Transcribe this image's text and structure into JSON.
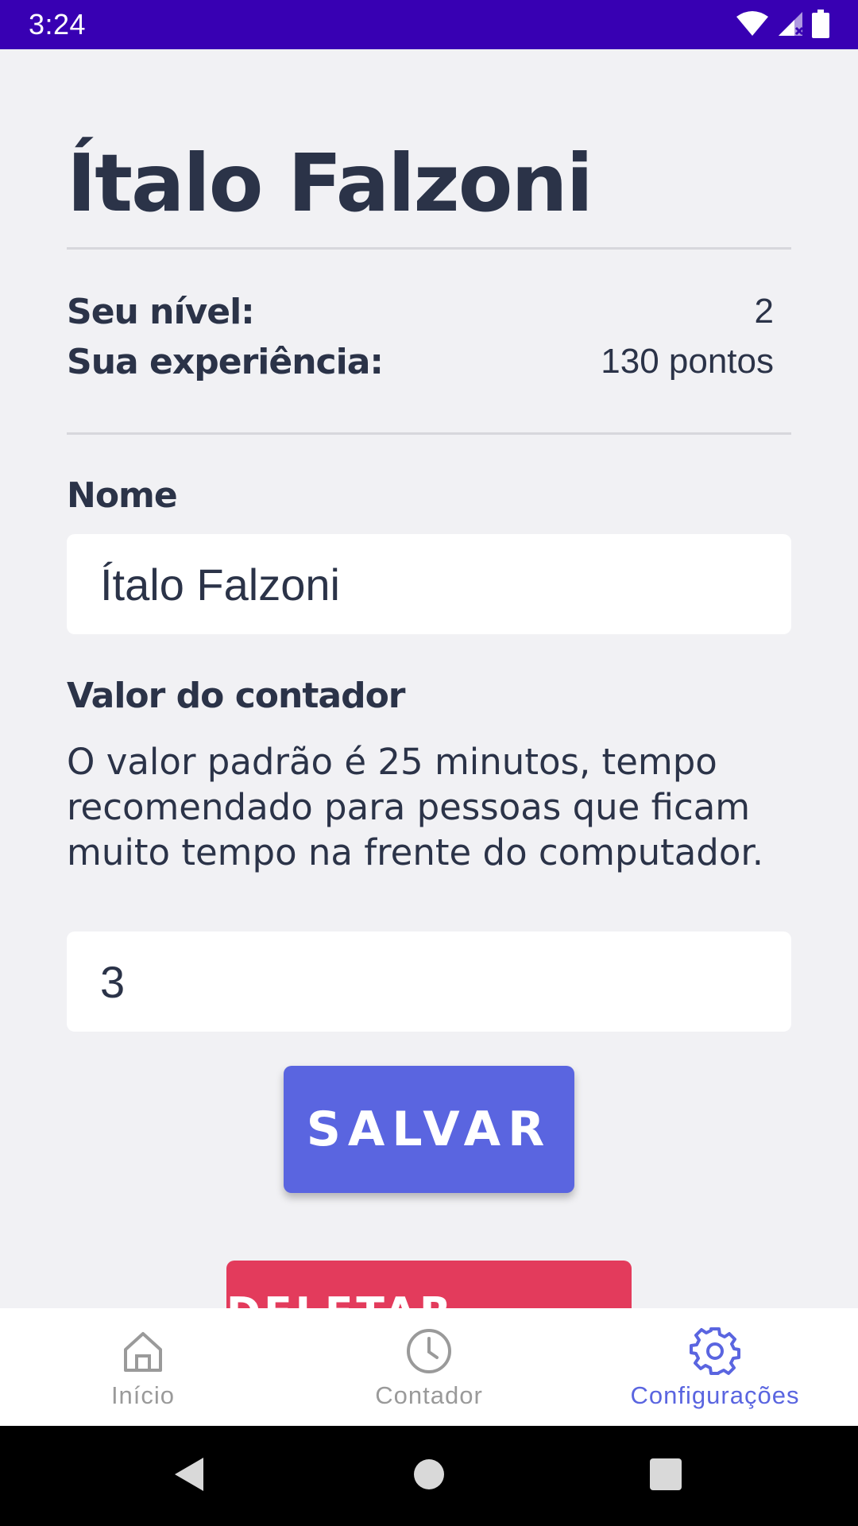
{
  "status_bar": {
    "time": "3:24"
  },
  "profile": {
    "name_title": "Ítalo Falzoni",
    "level_label": "Seu nível:",
    "level_value": "2",
    "xp_label": "Sua experiência:",
    "xp_value": "130 pontos"
  },
  "form": {
    "name_label": "Nome",
    "name_value": "Ítalo Falzoni",
    "counter_label": "Valor do contador",
    "counter_description": "O valor padrão é 25 minutos, tempo recomendado para pessoas que ficam muito tempo na frente do computador.",
    "counter_value": "3",
    "save_label": "SALVAR",
    "delete_label": "DELETAR DADOS"
  },
  "bottom_nav": {
    "items": [
      {
        "label": "Início",
        "icon": "home-icon",
        "active": false
      },
      {
        "label": "Contador",
        "icon": "clock-icon",
        "active": false
      },
      {
        "label": "Configurações",
        "icon": "gear-icon",
        "active": true
      }
    ]
  },
  "colors": {
    "status_bar": "#3800b3",
    "accent": "#5a65e0",
    "danger": "#e33b5c",
    "text": "#2b3348",
    "background": "#f1f1f4"
  }
}
